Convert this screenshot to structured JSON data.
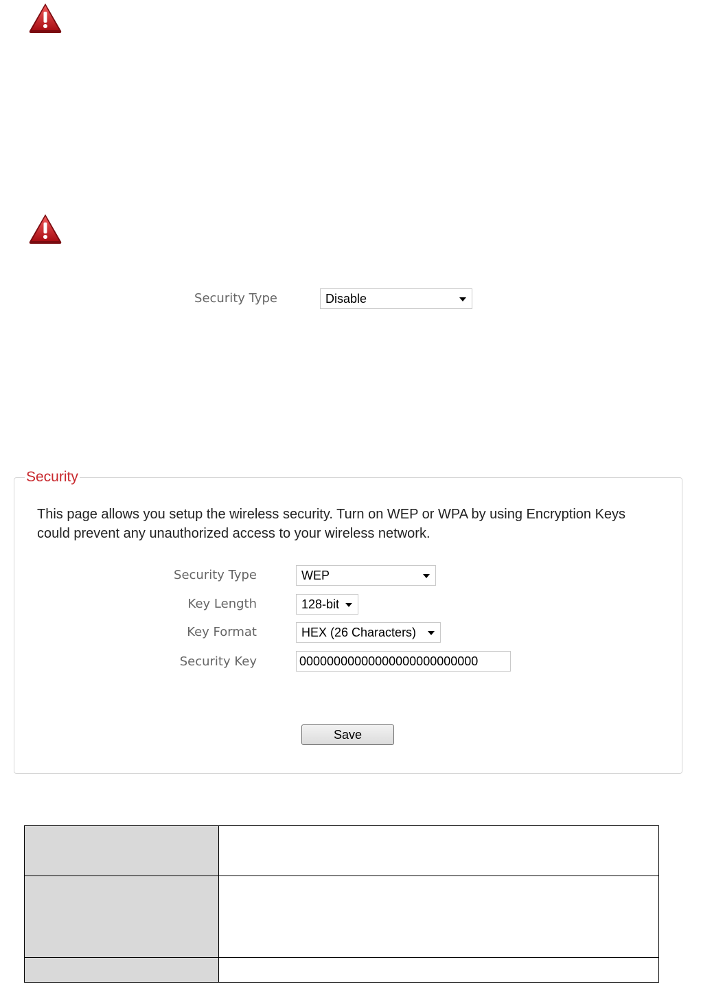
{
  "top_example": {
    "security_type_label": "Security Type",
    "security_type_value": "Disable"
  },
  "security_panel": {
    "legend": "Security",
    "description": "This page allows you setup the wireless security. Turn on WEP or WPA by using Encryption Keys could prevent any unauthorized access to your wireless network.",
    "fields": {
      "security_type_label": "Security Type",
      "security_type_value": "WEP",
      "key_length_label": "Key Length",
      "key_length_value": "128-bit",
      "key_format_label": "Key Format",
      "key_format_value": "HEX (26 Characters)",
      "security_key_label": "Security Key",
      "security_key_value": "00000000000000000000000000"
    },
    "save_label": "Save"
  },
  "icons": {
    "warning": "warning-icon"
  },
  "colors": {
    "legend_red": "#c8282d",
    "warning_red": "#c0141c",
    "table_key_bg": "#d9d9d9"
  }
}
